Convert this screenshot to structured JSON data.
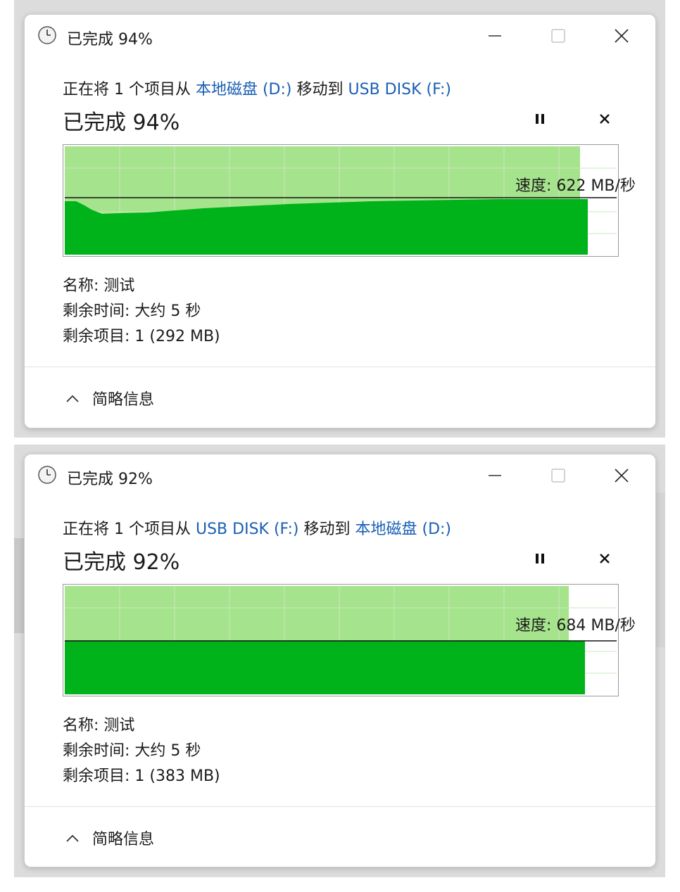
{
  "dialogs": [
    {
      "title": "已完成 94%",
      "op_prefix": "正在将 1 个项目从",
      "source": "本地磁盘 (D:)",
      "op_mid": "移动到",
      "dest": "USB DISK (F:)",
      "completed": "已完成 94%",
      "progress_percent": 94,
      "speed_text": "速度: 622 MB/秒",
      "name_text": "名称: 测试",
      "time_left_text": "剩余时间: 大约 5 秒",
      "items_left_text": "剩余项目: 1 (292 MB)",
      "details_toggle": "简略信息"
    },
    {
      "title": "已完成 92%",
      "op_prefix": "正在将 1 个项目从",
      "source": "USB DISK (F:)",
      "op_mid": "移动到",
      "dest": "本地磁盘 (D:)",
      "completed": "已完成 92%",
      "progress_percent": 92,
      "speed_text": "速度: 684 MB/秒",
      "name_text": "名称: 测试",
      "time_left_text": "剩余时间: 大约 5 秒",
      "items_left_text": "剩余项目: 1 (383 MB)",
      "details_toggle": "简略信息"
    }
  ],
  "colors": {
    "graph_light": "#a6e38d",
    "graph_dark": "#00b31b",
    "link": "#1a5fb4"
  },
  "icons": {
    "title": "clock-icon",
    "minimize": "minimize-icon",
    "maximize": "maximize-icon",
    "close": "close-icon",
    "pause": "pause-icon",
    "cancel": "cancel-icon",
    "collapse": "chevron-up-icon"
  }
}
